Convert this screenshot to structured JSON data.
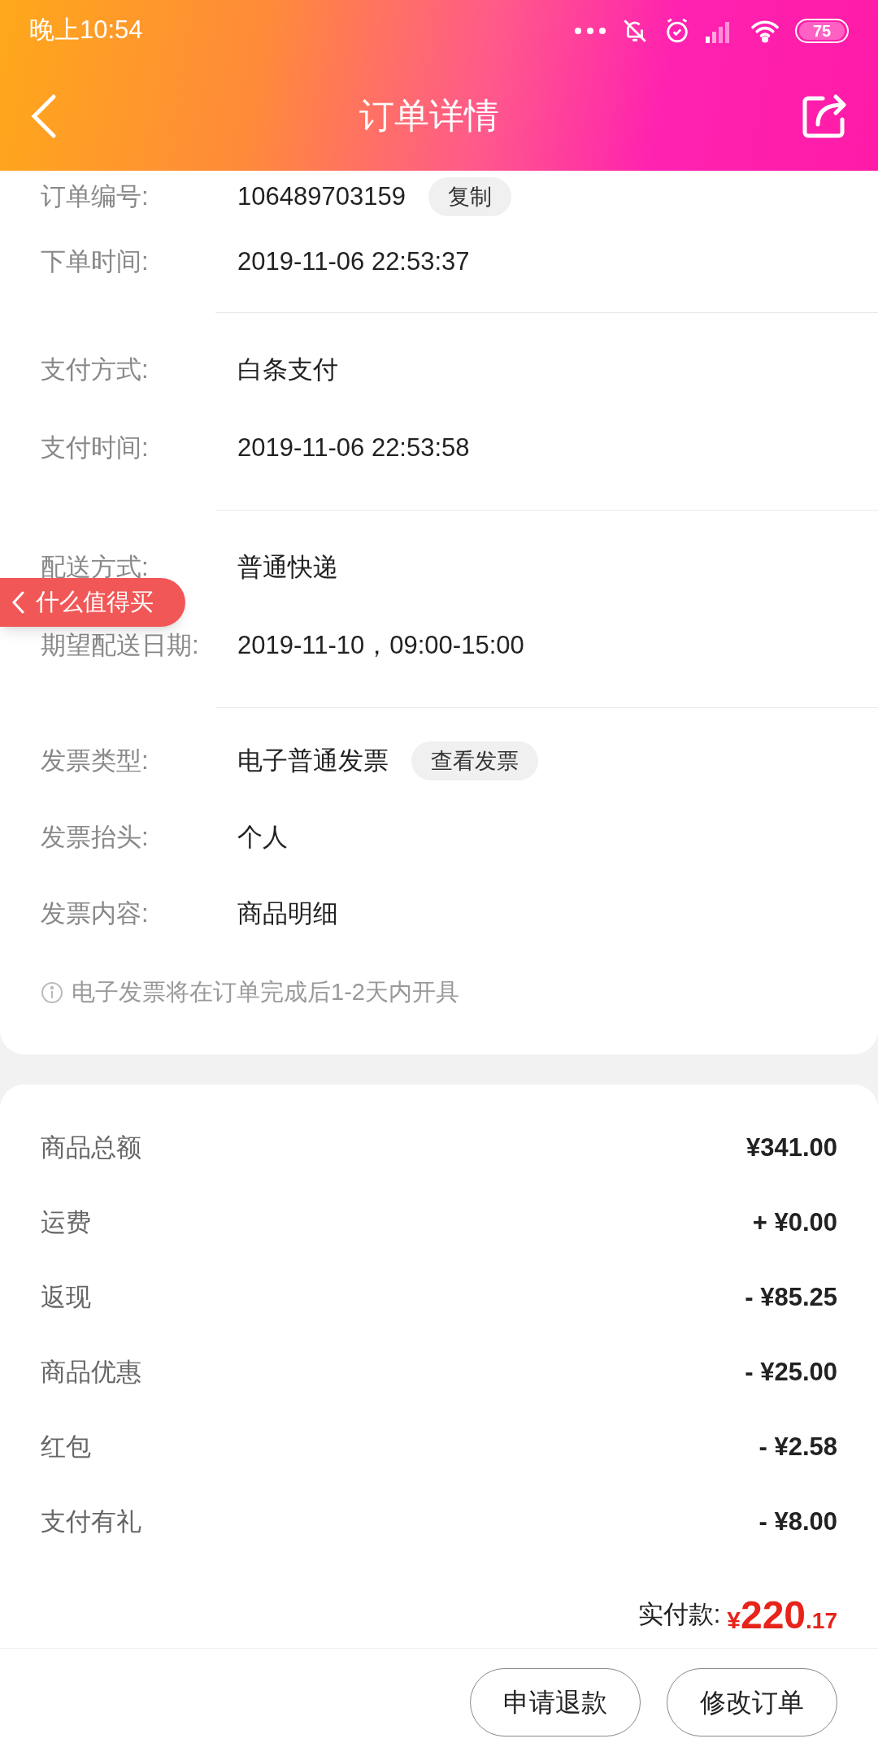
{
  "status_bar": {
    "time": "晚上10:54",
    "battery": "75"
  },
  "header": {
    "title": "订单详情"
  },
  "info_sections": [
    {
      "rows": [
        {
          "label": "订单编号:",
          "value": "106489703159",
          "button": "复制"
        },
        {
          "label": "下单时间:",
          "value": "2019-11-06 22:53:37"
        }
      ]
    },
    {
      "rows": [
        {
          "label": "支付方式:",
          "value": "白条支付"
        },
        {
          "label": "支付时间:",
          "value": "2019-11-06 22:53:58"
        }
      ]
    },
    {
      "rows": [
        {
          "label": "配送方式:",
          "value": "普通快递"
        },
        {
          "label": "期望配送日期:",
          "value": "2019-11-10，09:00-15:00"
        }
      ]
    },
    {
      "rows": [
        {
          "label": "发票类型:",
          "value": "电子普通发票",
          "button": "查看发票"
        },
        {
          "label": "发票抬头:",
          "value": "个人"
        },
        {
          "label": "发票内容:",
          "value": "商品明细"
        }
      ],
      "note": "电子发票将在订单完成后1-2天内开具"
    }
  ],
  "floating_tab": {
    "label": "什么值得买"
  },
  "price_rows": [
    {
      "label": "商品总额",
      "value": "¥341.00"
    },
    {
      "label": "运费",
      "value": "+ ¥0.00"
    },
    {
      "label": "返现",
      "value": "- ¥85.25"
    },
    {
      "label": "商品优惠",
      "value": "- ¥25.00"
    },
    {
      "label": "红包",
      "value": "- ¥2.58"
    },
    {
      "label": "支付有礼",
      "value": "- ¥8.00"
    }
  ],
  "total": {
    "label": "实付款:",
    "currency": "¥",
    "integer": "220",
    "decimal": ".17"
  },
  "actions": [
    "申请退款",
    "修改订单"
  ]
}
